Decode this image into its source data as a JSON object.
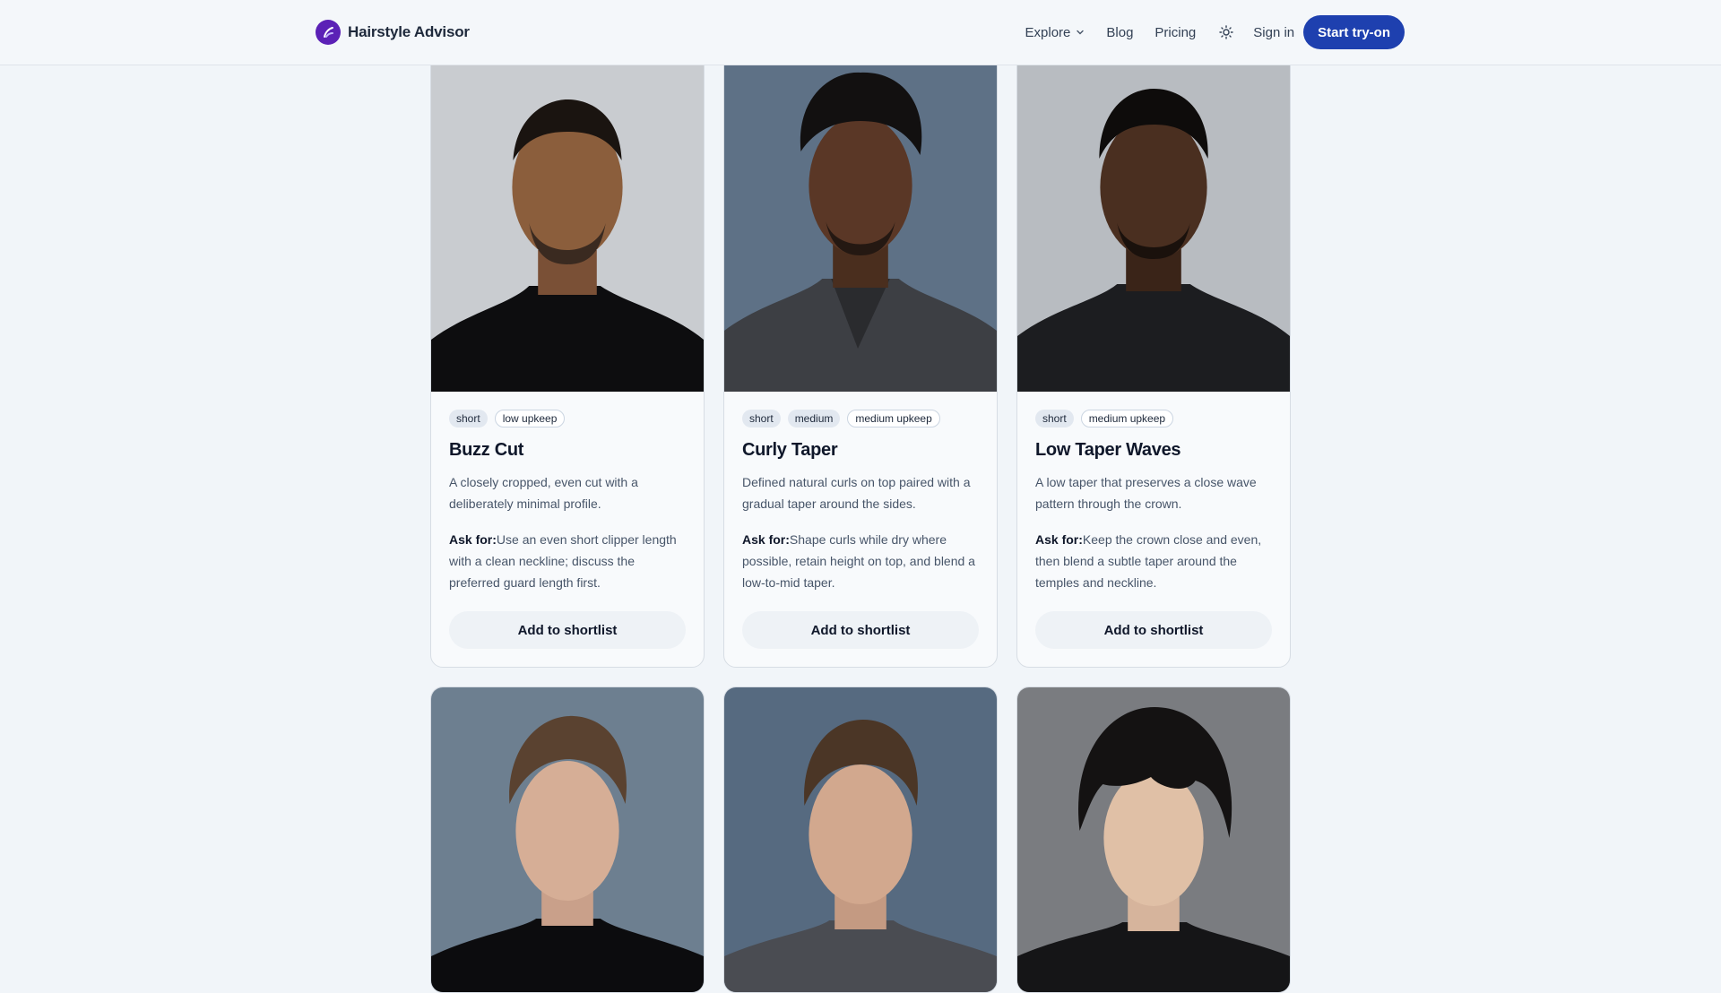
{
  "header": {
    "brand": "Hairstyle Advisor",
    "nav": [
      {
        "label": "Explore",
        "has_dropdown": true
      },
      {
        "label": "Blog"
      },
      {
        "label": "Pricing"
      }
    ],
    "theme_icon": "sun-icon",
    "signin_label": "Sign in",
    "cta_label": "Start try-on",
    "accent": "#1e40af"
  },
  "ask_label": "Ask for:",
  "cards": [
    {
      "tags": [
        {
          "text": "short",
          "style": "filled"
        },
        {
          "text": "low upkeep",
          "style": "outline"
        }
      ],
      "title": "Buzz Cut",
      "description": "A closely cropped, even cut with a deliberately minimal profile.",
      "ask": "Use an even short clipper length with a clean neckline; discuss the preferred guard length first.",
      "button": "Add to shortlist"
    },
    {
      "tags": [
        {
          "text": "short",
          "style": "filled"
        },
        {
          "text": "medium",
          "style": "filled"
        },
        {
          "text": "medium upkeep",
          "style": "outline"
        }
      ],
      "title": "Curly Taper",
      "description": "Defined natural curls on top paired with a gradual taper around the sides.",
      "ask": "Shape curls while dry where possible, retain height on top, and blend a low-to-mid taper.",
      "button": "Add to shortlist"
    },
    {
      "tags": [
        {
          "text": "short",
          "style": "filled"
        },
        {
          "text": "medium upkeep",
          "style": "outline"
        }
      ],
      "title": "Low Taper Waves",
      "description": "A low taper that preserves a close wave pattern through the crown.",
      "ask": "Keep the crown close and even, then blend a subtle taper around the temples and neckline.",
      "button": "Add to shortlist"
    }
  ]
}
